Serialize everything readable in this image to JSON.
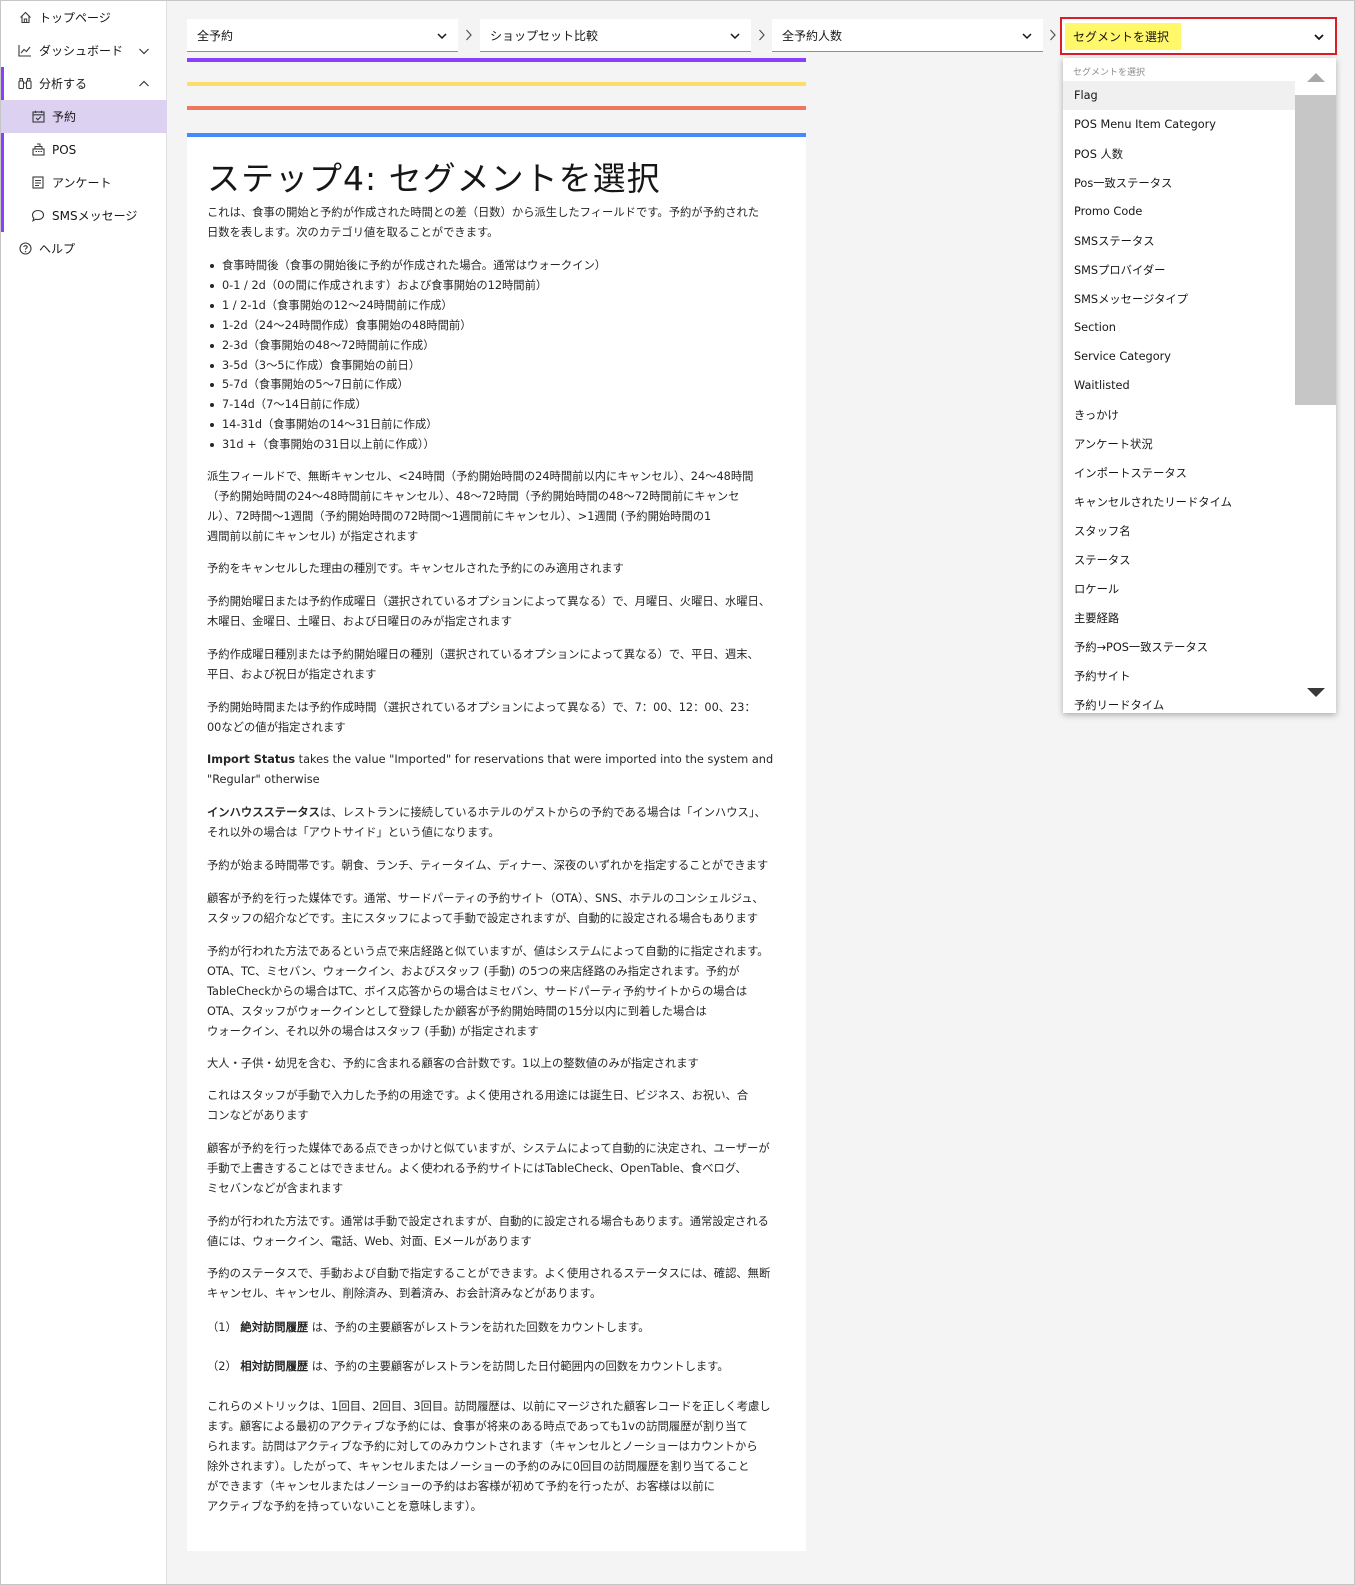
{
  "sidebar": {
    "items": [
      {
        "label": "トップページ",
        "icon": "home-icon"
      },
      {
        "label": "ダッシュボード",
        "icon": "chart-line-icon"
      },
      {
        "label": "分析する",
        "icon": "binoculars-icon"
      },
      {
        "label": "予約",
        "icon": "calendar-check-icon"
      },
      {
        "label": "POS",
        "icon": "cash-register-icon"
      },
      {
        "label": "アンケート",
        "icon": "survey-icon"
      },
      {
        "label": "SMSメッセージ",
        "icon": "chat-icon"
      },
      {
        "label": "ヘルプ",
        "icon": "help-icon"
      }
    ]
  },
  "toolbar": {
    "dropdowns": [
      {
        "value": "全予約"
      },
      {
        "value": "ショップセット比較"
      },
      {
        "value": "全予約人数"
      },
      {
        "value": "セグメントを選択"
      }
    ]
  },
  "stripe_colors": [
    "#8a3ffc",
    "#fddc69",
    "#ee775f",
    "#4589ff"
  ],
  "content": {
    "title": "ステップ4: セグメントを選択",
    "intro": [
      "これは、食事の開始と予約が作成された時間との差（日数）から派生したフィールドです。予約が予約された",
      "日数を表します。次のカテゴリ値を取ることができます。"
    ],
    "bullets": [
      "食事時間後（食事の開始後に予約が作成された場合。通常はウォークイン）",
      "0-1 / 2d（0の間に作成されます）および食事開始の12時間前）",
      "1 / 2-1d（食事開始の12〜24時間前に作成）",
      "1-2d（24〜24時間作成）食事開始の48時間前）",
      "2-3d（食事開始の48〜72時間前に作成）",
      "3-5d（3〜5に作成）食事開始の前日）",
      "5-7d（食事開始の5〜7日前に作成）",
      "7-14d（7〜14日前に作成）",
      "14-31d（食事開始の14〜31日前に作成）",
      "31d +（食事開始の31日以上前に作成））"
    ],
    "paragraphs": [
      {
        "lines": [
          "派生フィールドで、無断キャンセル、<24時間（予約開始時間の24時間前以内にキャンセル）、24〜48時間",
          "（予約開始時間の24〜48時間前にキャンセル）、48〜72時間（予約開始時間の48〜72時間前にキャンセ",
          "ル）、72時間〜1週間（予約開始時間の72時間〜1週間前にキャンセル）、>1週間 (予約開始時間の1",
          "週間前以前にキャンセル) が指定されます"
        ]
      },
      {
        "lines": [
          "予約をキャンセルした理由の種別です。キャンセルされた予約にのみ適用されます"
        ]
      },
      {
        "lines": [
          "予約開始曜日または予約作成曜日（選択されているオプションによって異なる）で、月曜日、火曜日、水曜日、",
          "木曜日、金曜日、土曜日、および日曜日のみが指定されます"
        ]
      },
      {
        "lines": [
          "予約作成曜日種別または予約開始曜日の種別（選択されているオプションによって異なる）で、平日、週末、",
          "平日、および祝日が指定されます"
        ]
      },
      {
        "lines": [
          "予約開始時間または予約作成時間（選択されているオプションによって異なる）で、7：00、12：00、23：",
          "00などの値が指定されます"
        ]
      },
      {
        "bold": "Import Status",
        "lines": [
          " takes the value \"Imported\" for reservations that were imported into the system and",
          " \"Regular\" otherwise"
        ]
      },
      {
        "bold": "インハウスステータス",
        "lines": [
          "は、レストランに接続しているホテルのゲストからの予約である場合は「インハウス」、",
          "それ以外の場合は「アウトサイド」という値になります。"
        ]
      },
      {
        "lines": [
          "予約が始まる時間帯です。朝食、ランチ、ティータイム、ディナー、深夜のいずれかを指定することができます"
        ]
      },
      {
        "lines": [
          "顧客が予約を行った媒体です。通常、サードパーティの予約サイト（OTA）、SNS、ホテルのコンシェルジュ、",
          "スタッフの紹介などです。主にスタッフによって手動で設定されますが、自動的に設定される場合もあります"
        ]
      },
      {
        "lines": [
          "予約が行われた方法であるという点で来店経路と似ていますが、値はシステムによって自動的に指定されます。",
          "OTA、TC、ミセバン、ウォークイン、およびスタッフ (手動) の5つの来店経路のみ指定されます。予約が",
          "TableCheckからの場合はTC、ボイス応答からの場合はミセバン、サードパーティ予約サイトからの場合は",
          "OTA、スタッフがウォークインとして登録したか顧客が予約開始時間の15分以内に到着した場合は",
          "ウォークイン、それ以外の場合はスタッフ (手動) が指定されます"
        ]
      },
      {
        "lines": [
          "大人・子供・幼児を含む、予約に含まれる顧客の合計数です。1以上の整数値のみが指定されます"
        ]
      },
      {
        "lines": [
          "これはスタッフが手動で入力した予約の用途です。よく使用される用途には誕生日、ビジネス、お祝い、合",
          "コンなどがあります"
        ]
      },
      {
        "lines": [
          "顧客が予約を行った媒体である点できっかけと似ていますが、システムによって自動的に決定され、ユーザーが",
          "手動で上書きすることはできません。よく使われる予約サイトにはTableCheck、OpenTable、食べログ、",
          "ミセバンなどが含まれます"
        ]
      },
      {
        "lines": [
          "予約が行われた方法です。通常は手動で設定されますが、自動的に設定される場合もあります。通常設定される",
          "値には、ウォークイン、電話、Web、対面、Eメールがあります"
        ]
      },
      {
        "lines": [
          "予約のステータスで、手動および自動で指定することができます。よく使用されるステータスには、確認、無断",
          "キャンセル、キャンセル、削除済み、到着済み、お会計済みなどがあります。"
        ]
      }
    ],
    "numbered": [
      {
        "prefix": "（1）",
        "bold": "絶対訪問履歴",
        "text": "は、予約の主要顧客がレストランを訪れた回数をカウントします。"
      },
      {
        "prefix": "（2）",
        "bold": "相対訪問履歴",
        "text": "は、予約の主要顧客がレストランを訪問した日付範囲内の回数をカウントします。"
      }
    ],
    "closing": [
      "これらのメトリックは、1回目、2回目、3回目。訪問履歴は、以前にマージされた顧客レコードを正しく考慮し",
      "ます。顧客による最初のアクティブな予約には、食事が将来のある時点であっても1vの訪問履歴が割り当て",
      "られます。訪問はアクティブな予約に対してのみカウントされます（キャンセルとノーショーはカウントから",
      "除外されます）。したがって、キャンセルまたはノーショーの予約のみに0回目の訪問履歴を割り当てること",
      "ができます（キャンセルまたはノーショーの予約はお客様が初めて予約を行ったが、お客様は以前に",
      "アクティブな予約を持っていないことを意味します）。"
    ]
  },
  "segment_menu": {
    "header": "セグメントを選択",
    "options": [
      "Flag",
      "POS Menu Item Category",
      "POS 人数",
      "Pos一致ステータス",
      "Promo Code",
      "SMSステータス",
      "SMSプロバイダー",
      "SMSメッセージタイプ",
      "Section",
      "Service Category",
      "Waitlisted",
      "きっかけ",
      "アンケート状況",
      "インポートステータス",
      "キャンセルされたリードタイム",
      "スタッフ名",
      "ステータス",
      "ロケール",
      "主要経路",
      "予約→POS一致ステータス",
      "予約サイト",
      "予約リードタイム"
    ]
  }
}
